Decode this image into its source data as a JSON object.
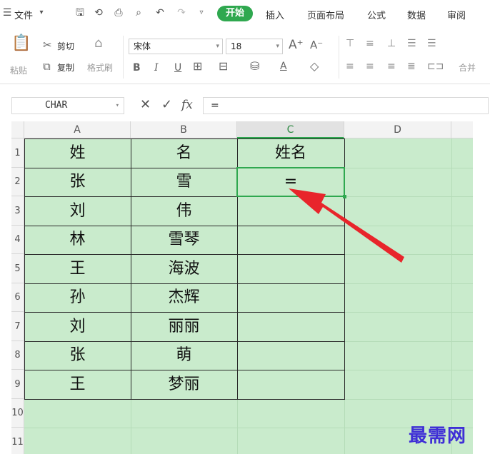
{
  "menubar": {
    "file_label": "文件",
    "start_label": "开始",
    "insert_label": "插入",
    "page_layout_label": "页面布局",
    "formula_label": "公式",
    "data_label": "数据",
    "review_label": "审阅"
  },
  "ribbon": {
    "paste_label": "粘贴",
    "cut_label": "剪切",
    "copy_label": "复制",
    "format_painter_label": "格式刷",
    "font_name": "宋体",
    "font_size": "18",
    "merge_label": "合并"
  },
  "formula_bar": {
    "name_box": "CHAR",
    "fx_label": "fx",
    "formula_value": "="
  },
  "sheet": {
    "columns": [
      "A",
      "B",
      "C",
      "D"
    ],
    "selected_column": "C",
    "rows": [
      "1",
      "2",
      "3",
      "4",
      "5",
      "6",
      "7",
      "8",
      "9",
      "10",
      "11"
    ],
    "cells": [
      [
        "姓",
        "名",
        "姓名"
      ],
      [
        "张",
        "雪",
        "="
      ],
      [
        "刘",
        "伟",
        ""
      ],
      [
        "林",
        "雪琴",
        ""
      ],
      [
        "王",
        "海波",
        ""
      ],
      [
        "孙",
        "杰辉",
        ""
      ],
      [
        "刘",
        "丽丽",
        ""
      ],
      [
        "张",
        "萌",
        ""
      ],
      [
        "王",
        "梦丽",
        ""
      ]
    ],
    "active_cell": "C2"
  },
  "watermark": "最需网",
  "colors": {
    "accent": "#2fa84f",
    "sheet_bg": "#c9ebcc",
    "arrow": "#e8252b",
    "watermark": "#3f2fd6"
  }
}
